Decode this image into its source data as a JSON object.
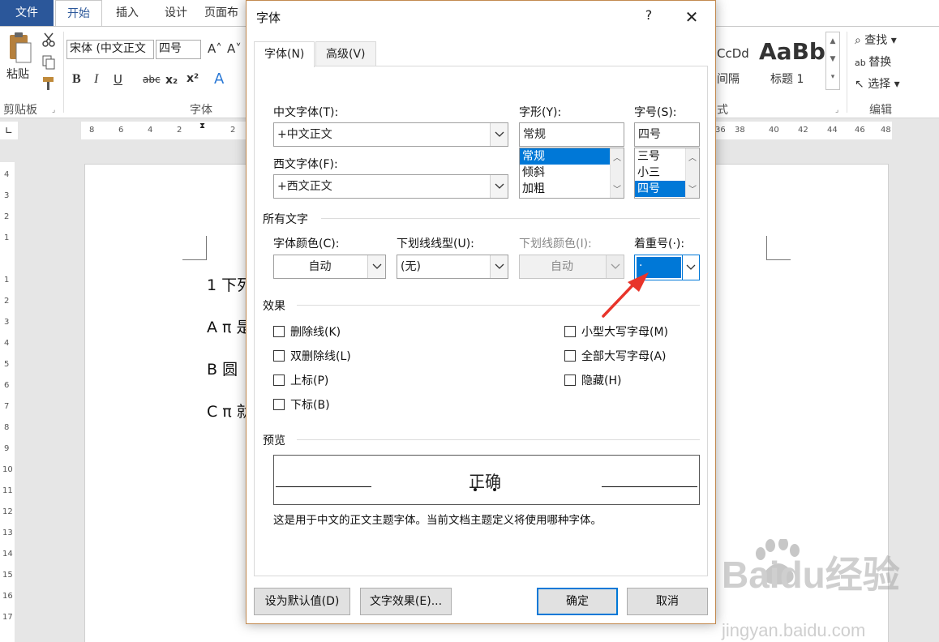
{
  "word": {
    "tabs": [
      "文件",
      "开始",
      "插入",
      "设计",
      "页面布"
    ],
    "clipboard": {
      "paste": "粘贴",
      "group_label": "剪贴板"
    },
    "font_group": {
      "font_name": "宋体 (中文正文",
      "font_size": "四号",
      "group_label": "字体"
    },
    "styles": {
      "sample1": "CcDd",
      "sample1_label": "间隔",
      "sample2": "AaBb",
      "sample2_label": "标题 1",
      "group_label": "式"
    },
    "editing": {
      "find": "查找",
      "replace": "替换",
      "select": "选择",
      "group_label": "编辑"
    },
    "ruler_h_left": [
      "8",
      "6",
      "4",
      "2",
      "2"
    ],
    "ruler_h_right": [
      "36",
      "38",
      "40",
      "42",
      "44",
      "46",
      "48"
    ],
    "ruler_v": [
      "4",
      "3",
      "2",
      "1",
      "1",
      "1",
      "2",
      "3",
      "4",
      "5",
      "6",
      "7",
      "8",
      "9",
      "10",
      "11",
      "12",
      "13",
      "14",
      "15",
      "16",
      "17"
    ],
    "doc_lines": [
      "1 下列",
      "A π 是",
      "B  圆",
      "C π 就"
    ]
  },
  "dialog": {
    "title": "字体",
    "help": "?",
    "tabs": {
      "font": "字体(N)",
      "advanced": "高级(V)"
    },
    "cn_font_label": "中文字体(T):",
    "cn_font_value": "+中文正文",
    "west_font_label": "西文字体(F):",
    "west_font_value": "+西文正文",
    "style_label": "字形(Y):",
    "style_value": "常规",
    "style_options": [
      "常规",
      "倾斜",
      "加粗"
    ],
    "size_label": "字号(S):",
    "size_value": "四号",
    "size_options": [
      "三号",
      "小三",
      "四号"
    ],
    "all_text_section": "所有文字",
    "font_color_label": "字体颜色(C):",
    "font_color_value": "自动",
    "underline_label": "下划线线型(U):",
    "underline_value": "(无)",
    "underline_color_label": "下划线颜色(I):",
    "underline_color_value": "自动",
    "emphasis_label": "着重号(·):",
    "emphasis_value": "·",
    "effects_section": "效果",
    "effects_left": [
      "删除线(K)",
      "双删除线(L)",
      "上标(P)",
      "下标(B)"
    ],
    "effects_right": [
      "小型大写字母(M)",
      "全部大写字母(A)",
      "隐藏(H)"
    ],
    "preview_section": "预览",
    "preview_text": "正确",
    "preview_desc": "这是用于中文的正文主题字体。当前文档主题定义将使用哪种字体。",
    "buttons": {
      "set_default": "设为默认值(D)",
      "text_effects": "文字效果(E)...",
      "ok": "确定",
      "cancel": "取消"
    }
  },
  "watermark": {
    "brand": "Baidu经验",
    "url": "jingyan.baidu.com"
  },
  "colors": {
    "accent": "#2b579a",
    "selection": "#0078d7",
    "arrow": "#e8342a"
  }
}
